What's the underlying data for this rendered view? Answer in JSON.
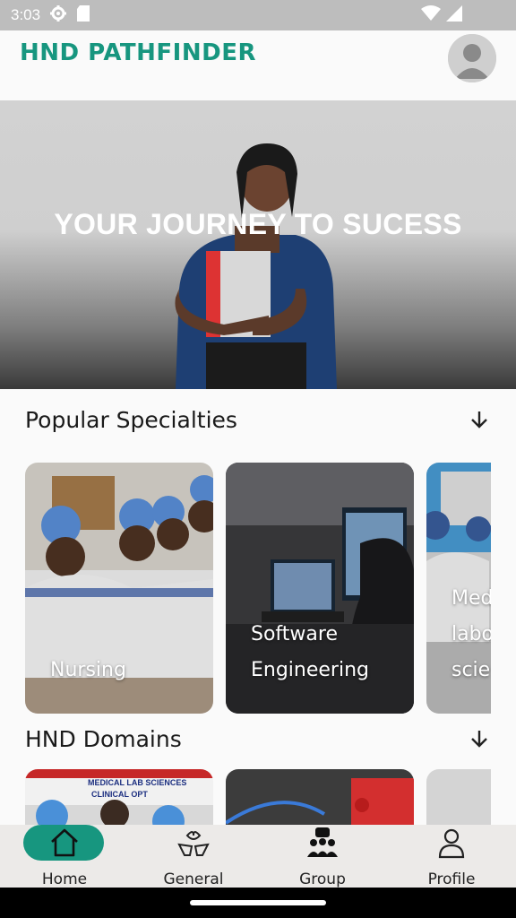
{
  "status_bar": {
    "time": "3:03",
    "icons": [
      "settings-icon",
      "sd-card-icon",
      "wifi-icon",
      "signal-icon"
    ]
  },
  "app_bar": {
    "title": "HND PATHFINDER",
    "avatar_icon": "user-avatar-icon",
    "accent_color": "#17967f"
  },
  "hero": {
    "headline": "YOUR JOURNEY TO SUCESS"
  },
  "popular": {
    "title": "Popular Specialties",
    "expand_icon": "arrow-down-icon",
    "cards": [
      {
        "label": "Nursing"
      },
      {
        "label_line1": "Software",
        "label_line2": "Engineering"
      },
      {
        "label_line1": "Med",
        "label_line2": "labo",
        "label_line3": "scie"
      }
    ]
  },
  "domains": {
    "title": "HND Domains",
    "expand_icon": "arrow-down-icon",
    "banner_line1": "MEDICAL LAB SCIENCES",
    "banner_line2": "CLINICAL OPT"
  },
  "bottom_nav": {
    "items": [
      {
        "label": "Home",
        "icon": "home-icon",
        "active": true
      },
      {
        "label": "General",
        "icon": "general-icon",
        "active": false
      },
      {
        "label": "Group",
        "icon": "group-icon",
        "active": false
      },
      {
        "label": "Profile",
        "icon": "profile-icon",
        "active": false
      }
    ]
  }
}
